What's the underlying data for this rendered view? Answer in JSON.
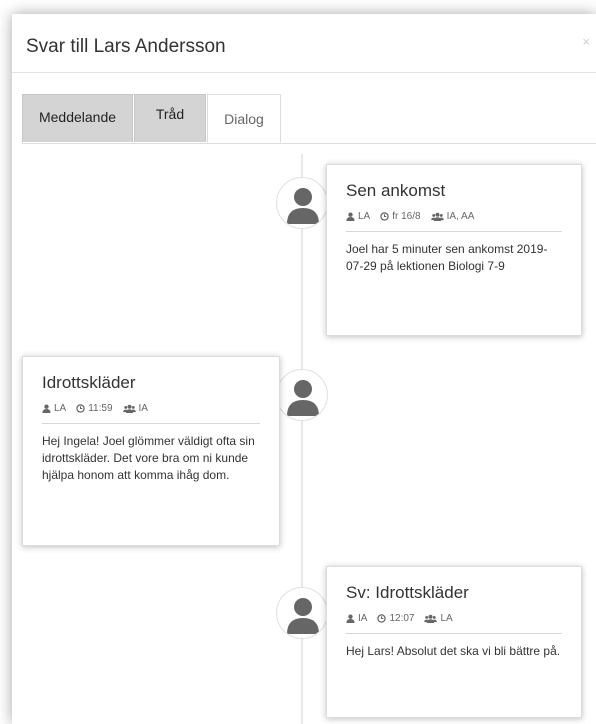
{
  "modal": {
    "title": "Svar till Lars Andersson",
    "close_label": "×"
  },
  "tabs": [
    {
      "label": "Meddelande",
      "active": false
    },
    {
      "label": "Tråd",
      "active": false
    },
    {
      "label": "Dialog",
      "active": true
    }
  ],
  "messages": [
    {
      "title": "Sen ankomst",
      "author": "LA",
      "time": "fr 16/8",
      "recipients": "IA, AA",
      "body": "Joel har 5 minuter sen ankomst 2019-07-29 på lektionen Biologi 7-9",
      "side": "right"
    },
    {
      "title": "Idrottskläder",
      "author": "LA",
      "time": "11:59",
      "recipients": "IA",
      "body": "Hej Ingela! Joel glömmer väldigt ofta sin idrottskläder. Det vore bra om ni kunde hjälpa honom att komma ihåg dom.",
      "side": "left"
    },
    {
      "title": "Sv: Idrottskläder",
      "author": "IA",
      "time": "12:07",
      "recipients": "LA",
      "body": "Hej Lars! Absolut det ska vi bli bättre på.",
      "side": "right"
    }
  ],
  "icons": {
    "user": "user-icon",
    "clock": "clock-icon",
    "group": "group-icon",
    "avatar": "avatar-icon"
  },
  "colors": {
    "tab_inactive_bg": "#d4d4d4",
    "avatar_fill": "#666666",
    "meta_icon": "#666666"
  }
}
